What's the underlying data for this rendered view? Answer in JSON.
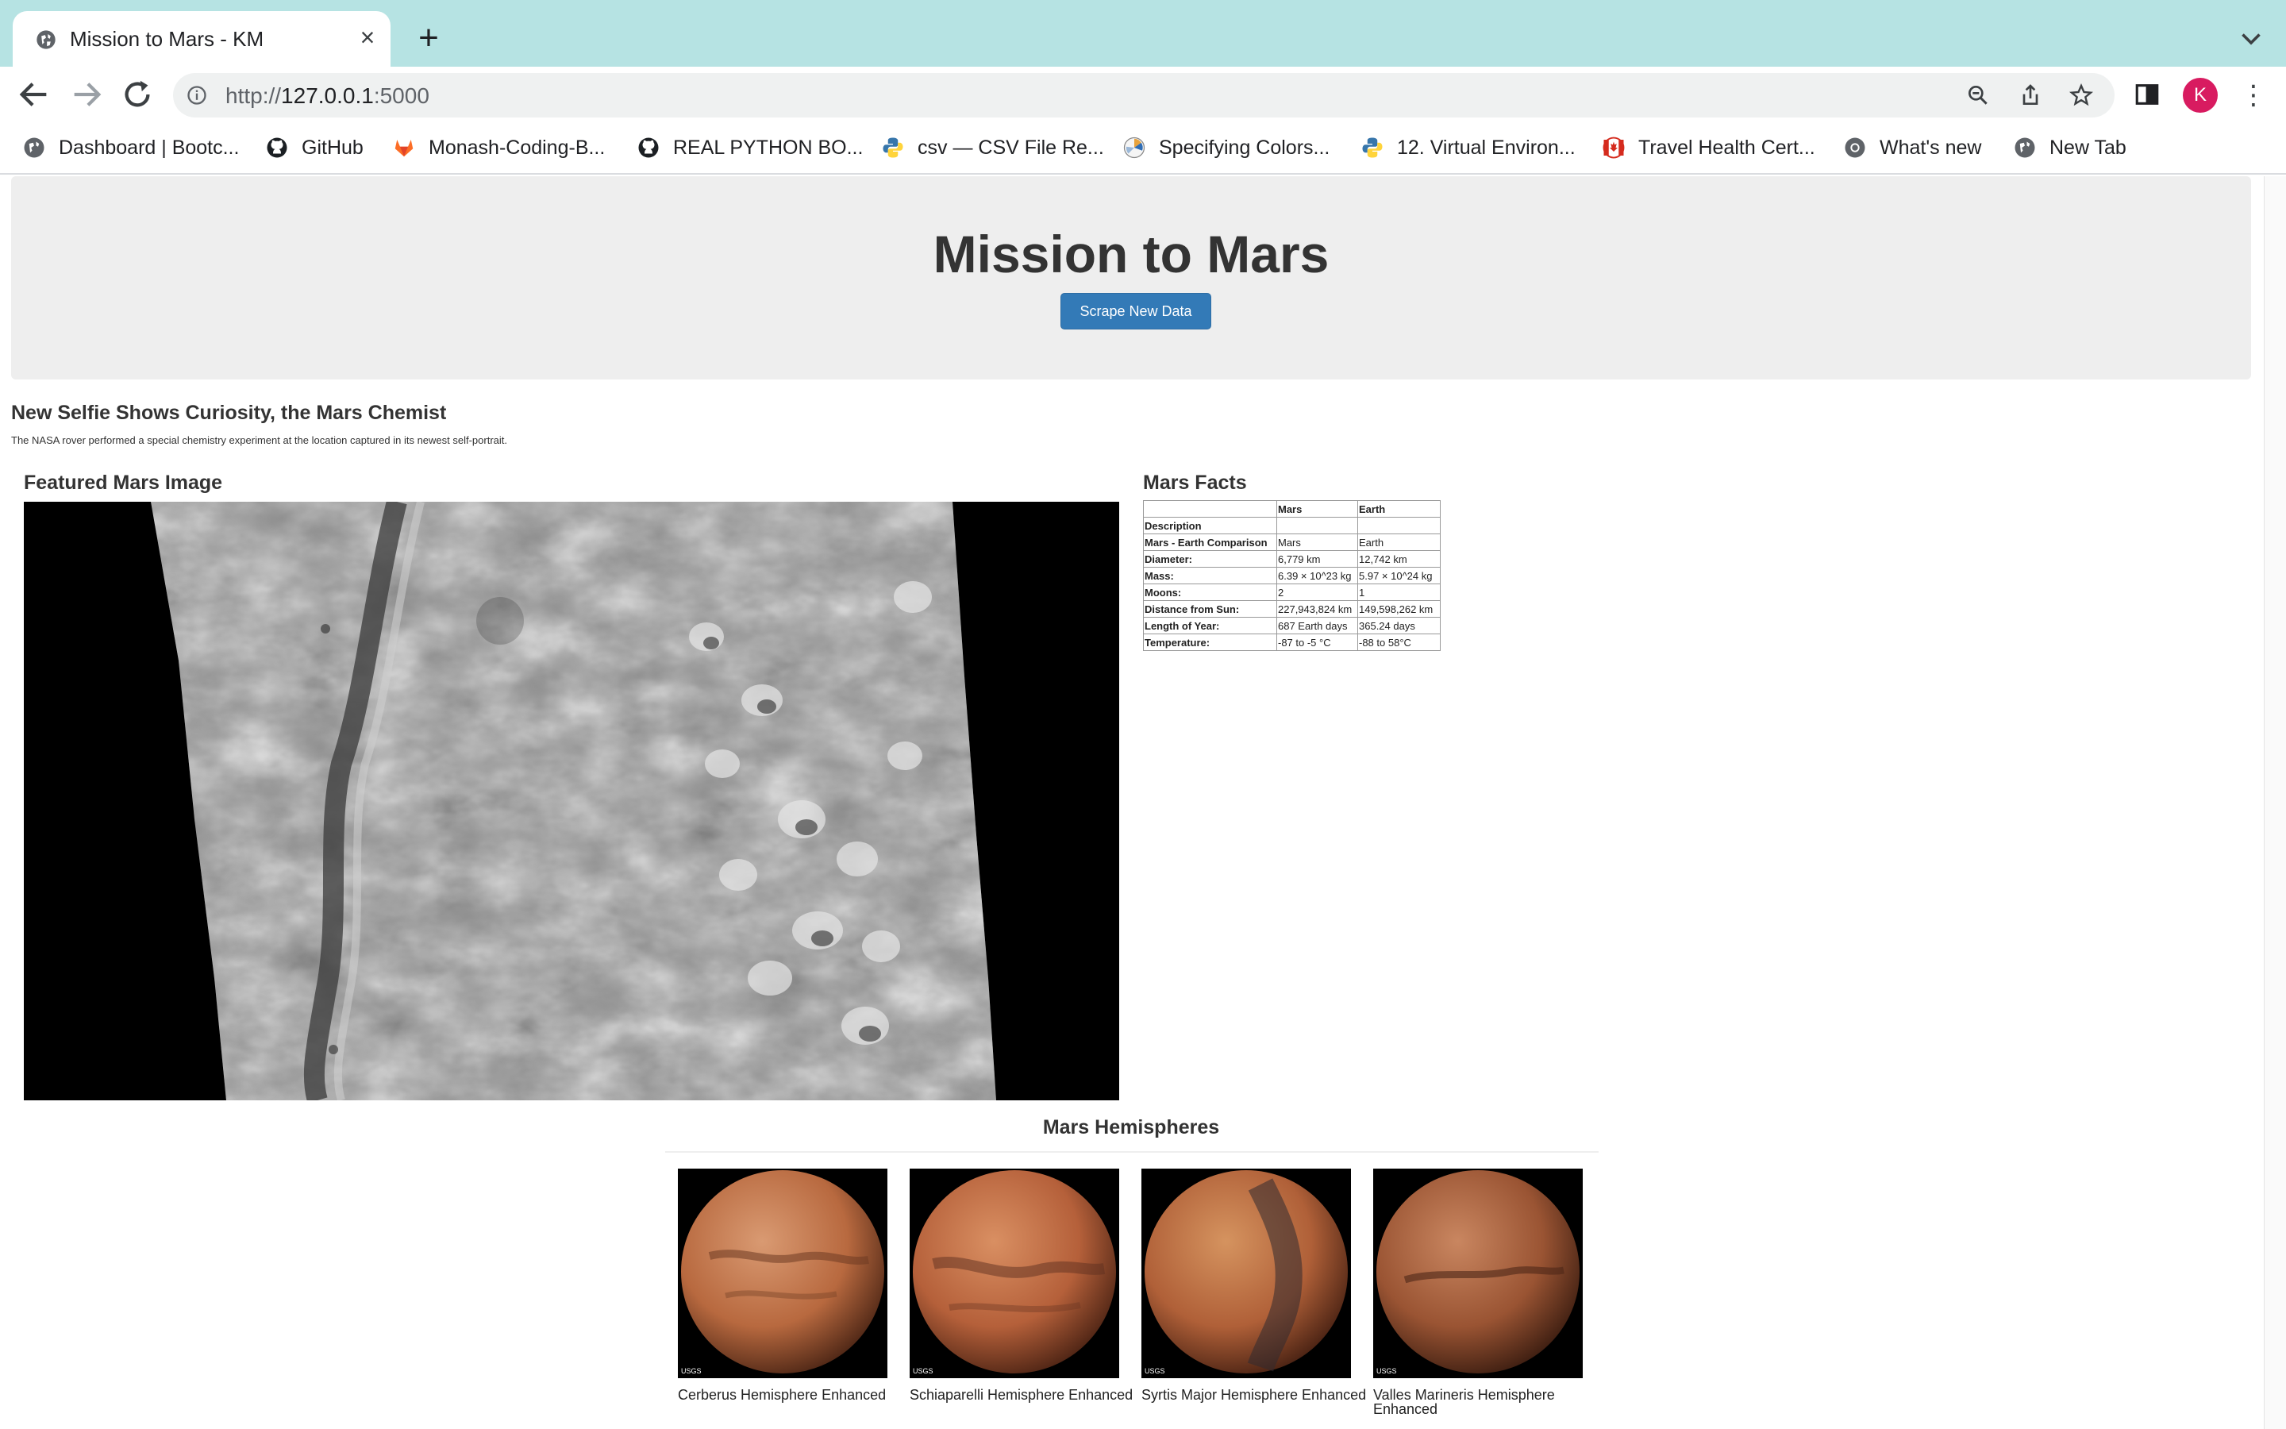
{
  "browser": {
    "tab_title": "Mission to Mars - KM",
    "new_tab_symbol": "+",
    "close_symbol": "×",
    "url_scheme": "http://",
    "url_host": "127.0.0.1",
    "url_port": ":5000",
    "avatar_letter": "K",
    "menu_symbol": "⋮",
    "bookmarks": [
      {
        "label": "Dashboard | Bootc...",
        "icon": "globe-icon"
      },
      {
        "label": "GitHub",
        "icon": "github-icon"
      },
      {
        "label": "Monash-Coding-B...",
        "icon": "gitlab-icon"
      },
      {
        "label": "REAL PYTHON BO...",
        "icon": "github-icon"
      },
      {
        "label": "csv — CSV File Re...",
        "icon": "python-icon"
      },
      {
        "label": "Specifying Colors...",
        "icon": "matplotlib-icon"
      },
      {
        "label": "12. Virtual Environ...",
        "icon": "python-icon"
      },
      {
        "label": "Travel Health Cert...",
        "icon": "canada-flag-icon"
      },
      {
        "label": "What's new",
        "icon": "chrome-icon"
      },
      {
        "label": "New Tab",
        "icon": "globe-icon"
      }
    ]
  },
  "page": {
    "heading": "Mission to Mars",
    "scrape_button": "Scrape New Data",
    "news": {
      "title": "New Selfie Shows Curiosity, the Mars Chemist",
      "teaser": "The NASA rover performed a special chemistry experiment at the location captured in its newest self-portrait."
    },
    "featured_heading": "Featured Mars Image",
    "facts_heading": "Mars Facts",
    "facts_table": {
      "columns": [
        "",
        "Mars",
        "Earth"
      ],
      "rows": [
        [
          "Description",
          "",
          ""
        ],
        [
          "Mars - Earth Comparison",
          "Mars",
          "Earth"
        ],
        [
          "Diameter:",
          "6,779 km",
          "12,742 km"
        ],
        [
          "Mass:",
          "6.39 × 10^23 kg",
          "5.97 × 10^24 kg"
        ],
        [
          "Moons:",
          "2",
          "1"
        ],
        [
          "Distance from Sun:",
          "227,943,824 km",
          "149,598,262 km"
        ],
        [
          "Length of Year:",
          "687 Earth days",
          "365.24 days"
        ],
        [
          "Temperature:",
          "-87 to -5 °C",
          "-88 to 58°C"
        ]
      ]
    },
    "hemispheres_heading": "Mars Hemispheres",
    "hemispheres": [
      {
        "title": "Cerberus Hemisphere Enhanced",
        "tone": "#b8693f"
      },
      {
        "title": "Schiaparelli Hemisphere Enhanced",
        "tone": "#b5603a"
      },
      {
        "title": "Syrtis Major Hemisphere Enhanced",
        "tone": "#b06038"
      },
      {
        "title": "Valles Marineris Hemisphere Enhanced",
        "tone": "#9a5433"
      }
    ],
    "usgs_label": "USGS"
  }
}
